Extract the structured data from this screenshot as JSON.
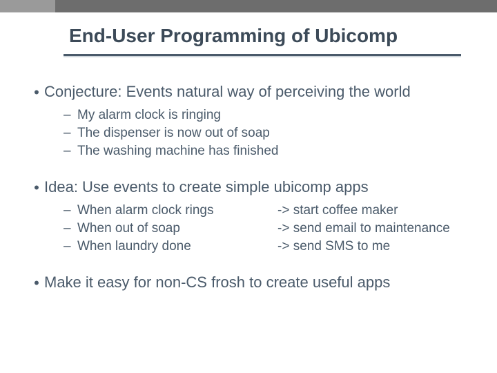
{
  "title": "End-User Programming of Ubicomp",
  "bullets": [
    {
      "text": "Conjecture: Events natural way of perceiving the world",
      "subs": [
        "My alarm clock is ringing",
        "The dispenser is now out of soap",
        "The washing machine has finished"
      ]
    },
    {
      "text": "Idea: Use events to create simple ubicomp apps",
      "pairs": [
        {
          "left": "When alarm clock rings",
          "right": "-> start coffee maker"
        },
        {
          "left": "When out of soap",
          "right": "-> send email to maintenance"
        },
        {
          "left": "When laundry done",
          "right": "-> send SMS to me"
        }
      ]
    },
    {
      "text": "Make it easy for non-CS frosh to create useful apps"
    }
  ]
}
